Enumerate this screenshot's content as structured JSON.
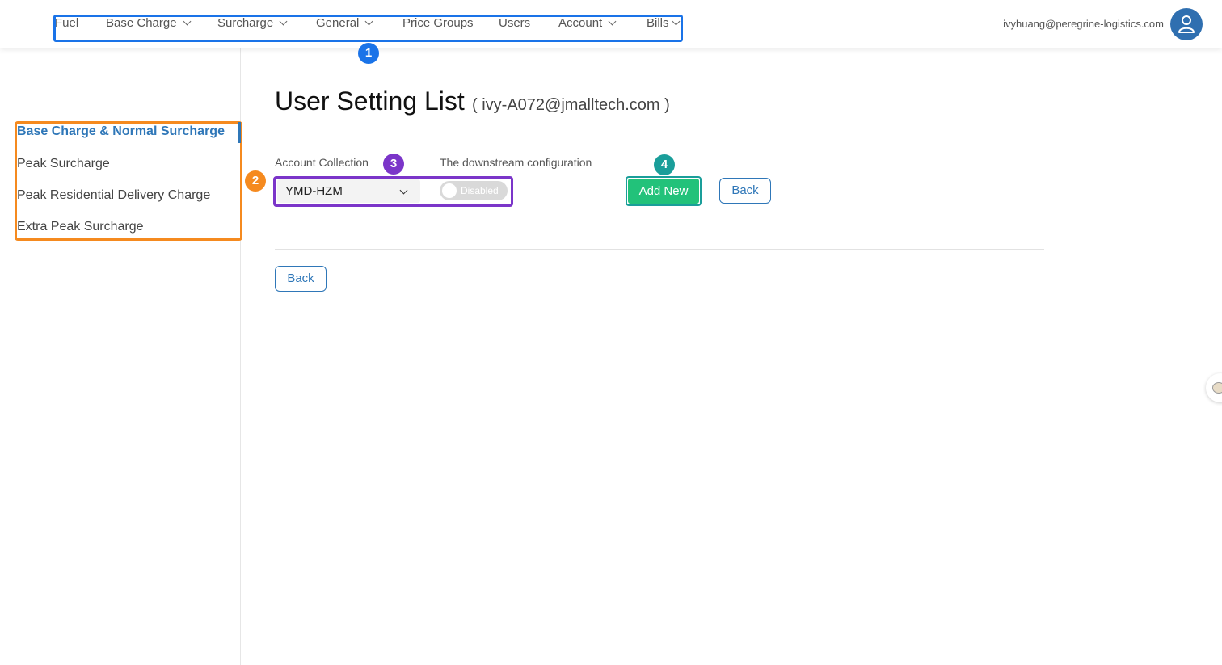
{
  "nav": {
    "items": [
      {
        "label": "Fuel",
        "dropdown": false
      },
      {
        "label": "Base Charge",
        "dropdown": true
      },
      {
        "label": "Surcharge",
        "dropdown": true
      },
      {
        "label": "General",
        "dropdown": true
      },
      {
        "label": "Price Groups",
        "dropdown": false
      },
      {
        "label": "Users",
        "dropdown": false
      },
      {
        "label": "Account",
        "dropdown": true
      },
      {
        "label": "Bills",
        "dropdown": true
      }
    ]
  },
  "user": {
    "email": "ivyhuang@peregrine-logistics.com",
    "avatar_icon": "user-icon"
  },
  "badges": {
    "one": "1",
    "two": "2",
    "three": "3",
    "four": "4"
  },
  "sidebar": {
    "items": [
      {
        "label": "Base Charge & Normal Surcharge",
        "active": true
      },
      {
        "label": "Peak Surcharge",
        "active": false
      },
      {
        "label": "Peak Residential Delivery Charge",
        "active": false
      },
      {
        "label": "Extra Peak Surcharge",
        "active": false
      }
    ]
  },
  "main": {
    "title": "User Setting List",
    "subtitle": "( ivy-A072@jmalltech.com )",
    "account_collection_label": "Account Collection",
    "account_collection_value": "YMD-HZM",
    "downstream_label": "The downstream configuration",
    "downstream_toggle_text": "Disabled",
    "add_new_label": "Add New",
    "back_label": "Back",
    "back_bottom_label": "Back"
  },
  "colors": {
    "accent": "#2f77b8",
    "success": "#22c27a",
    "callout_blue": "#1a73e8",
    "callout_orange": "#f58a1f",
    "callout_purple": "#7b35c9",
    "callout_teal": "#1a9e9a"
  }
}
